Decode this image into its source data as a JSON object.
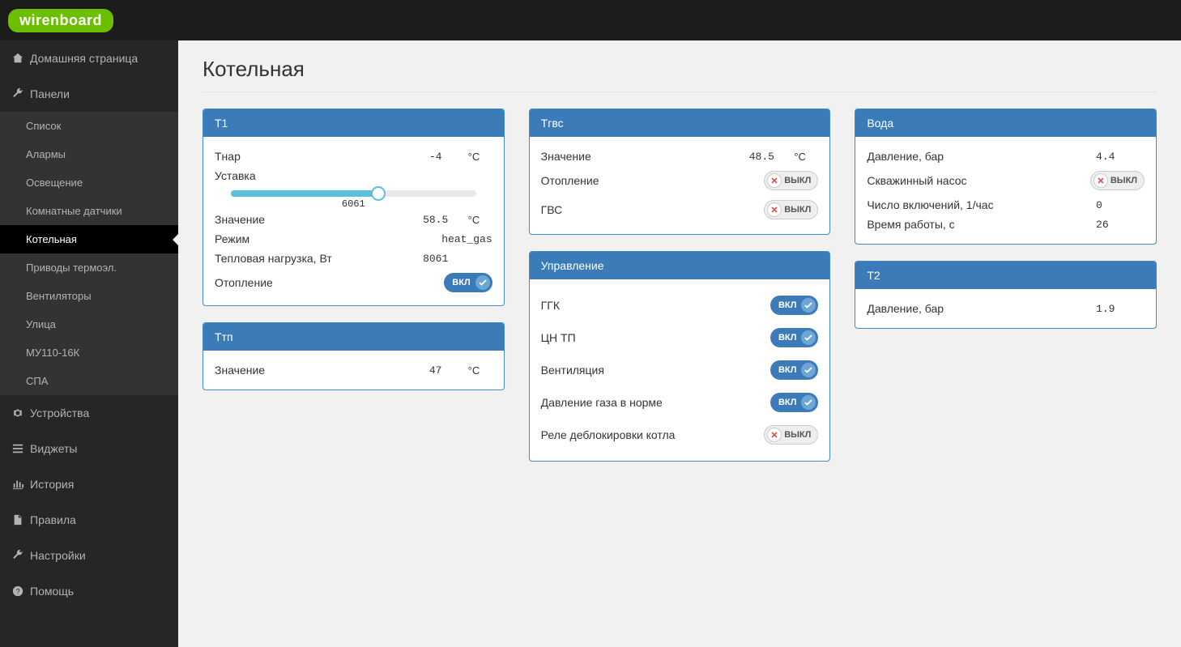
{
  "brand": "wirenboard",
  "nav": {
    "home": "Домашняя страница",
    "dashboards": "Панели",
    "items": [
      "Список",
      "Алармы",
      "Освещение",
      "Комнатные датчики",
      "Котельная",
      "Приводы термоэл.",
      "Вентиляторы",
      "Улица",
      "МУ110-16К",
      "СПА"
    ],
    "active_index": 4,
    "devices": "Устройства",
    "widgets": "Виджеты",
    "history": "История",
    "rules": "Правила",
    "settings": "Настройки",
    "help": "Помощь"
  },
  "page": {
    "title": "Котельная"
  },
  "toggle_labels": {
    "on": "ВКЛ",
    "off": "ВЫКЛ"
  },
  "panels": {
    "t1": {
      "title": "T1",
      "tnar_label": "Тнар",
      "tnar_value": "-4",
      "tnar_unit": "°C",
      "setpoint_label": "Уставка",
      "slider": {
        "value": "6061",
        "percent": 60
      },
      "value_label": "Значение",
      "value_value": "58.5",
      "value_unit": "°C",
      "mode_label": "Режим",
      "mode_value": "heat_gas",
      "heatload_label": "Тепловая нагрузка, Вт",
      "heatload_value": "8061",
      "heating_label": "Отопление",
      "heating_on": true
    },
    "ttp": {
      "title": "Tтп",
      "value_label": "Значение",
      "value_value": "47",
      "value_unit": "°C"
    },
    "tgvs": {
      "title": "Tгвс",
      "value_label": "Значение",
      "value_value": "48.5",
      "value_unit": "°C",
      "heating_label": "Отопление",
      "heating_on": false,
      "gvs_label": "ГВС",
      "gvs_on": false
    },
    "control": {
      "title": "Управление",
      "rows": [
        {
          "label": "ГГК",
          "on": true
        },
        {
          "label": "ЦН ТП",
          "on": true
        },
        {
          "label": "Вентиляция",
          "on": true
        },
        {
          "label": "Давление газа в норме",
          "on": true
        },
        {
          "label": "Реле деблокировки котла",
          "on": false
        }
      ]
    },
    "water": {
      "title": "Вода",
      "pressure_label": "Давление, бар",
      "pressure_value": "4.4",
      "pump_label": "Скважинный насос",
      "pump_on": false,
      "oncount_label": "Число включений, 1/час",
      "oncount_value": "0",
      "runtime_label": "Время работы, с",
      "runtime_value": "26"
    },
    "t2": {
      "title": "T2",
      "pressure_label": "Давление, бар",
      "pressure_value": "1.9"
    }
  }
}
